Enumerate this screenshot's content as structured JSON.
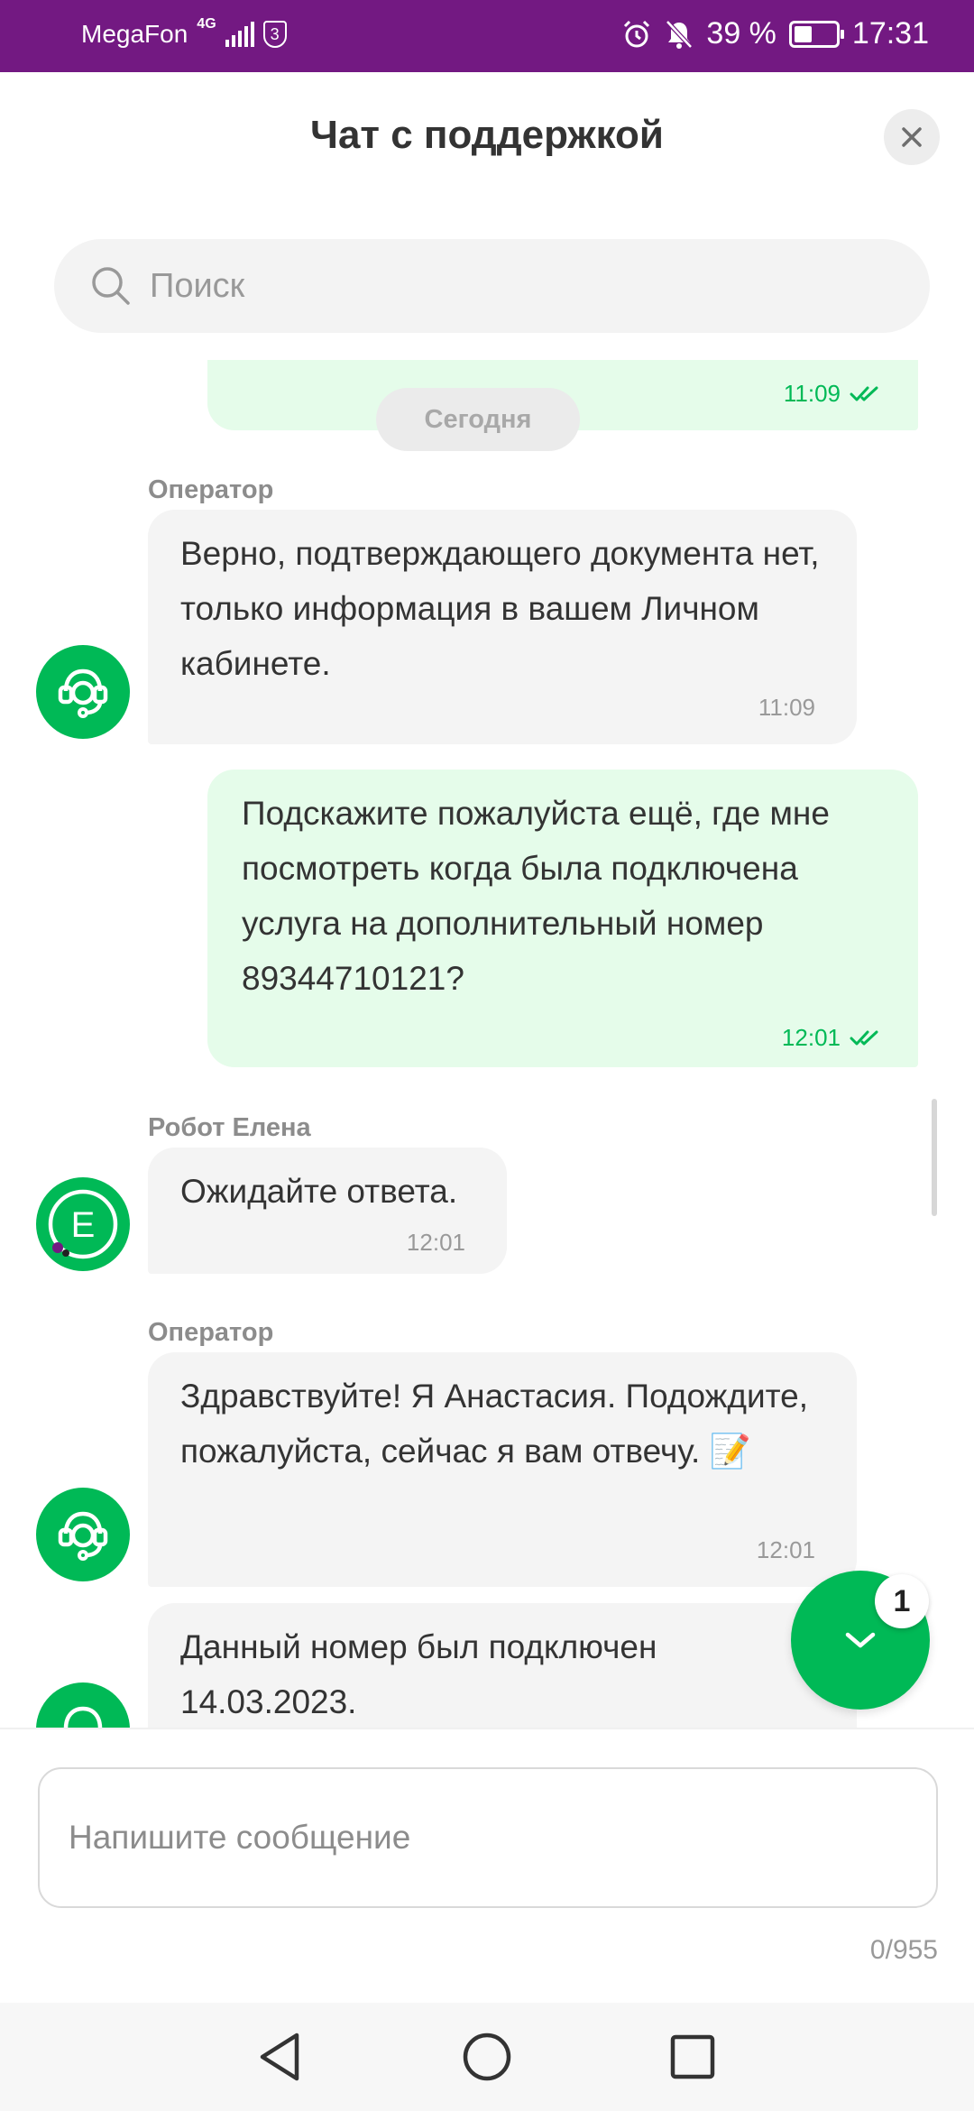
{
  "status_bar": {
    "carrier": "MegaFon",
    "network": "4G",
    "shield_number": "3",
    "battery": "39 %",
    "battery_level": 0.39,
    "time": "17:31"
  },
  "header": {
    "title": "Чат с поддержкой"
  },
  "search": {
    "placeholder": "Поиск"
  },
  "date_divider": "Сегодня",
  "messages": [
    {
      "direction": "out",
      "text": "",
      "time": "11:09",
      "status": "read"
    },
    {
      "direction": "in",
      "sender": "Оператор",
      "text": "Верно, подтверждающего документа нет, только информация в вашем Личном кабинете.",
      "time": "11:09",
      "avatar": "headset-icon"
    },
    {
      "direction": "out",
      "text": "Подскажите пожалуйста ещё, где мне посмотреть когда была подключена услуга на дополнительный номер 89344710121?",
      "time": "12:01",
      "status": "read"
    },
    {
      "direction": "in",
      "sender": "Робот Елена",
      "text": "Ожидайте ответа.",
      "time": "12:01",
      "avatar": "robot-e-icon",
      "avatar_letter": "E"
    },
    {
      "direction": "in",
      "sender": "Оператор",
      "text": "Здравствуйте! Я Анастасия. Подождите, пожалуйста, сейчас я вам отвечу. 📝",
      "time": "12:01",
      "avatar": "headset-icon"
    },
    {
      "direction": "in",
      "text": "Данный номер был подключен 14.03.2023.",
      "avatar": "headset-icon"
    }
  ],
  "fab": {
    "icon": "chevron-down-icon",
    "badge": "1"
  },
  "composer": {
    "placeholder": "Напишите сообщение",
    "counter": "0/955"
  },
  "colors": {
    "status_bar": "#731982",
    "accent": "#00b956",
    "outgoing_bubble": "#e5fcea",
    "incoming_bubble": "#f4f4f4"
  }
}
